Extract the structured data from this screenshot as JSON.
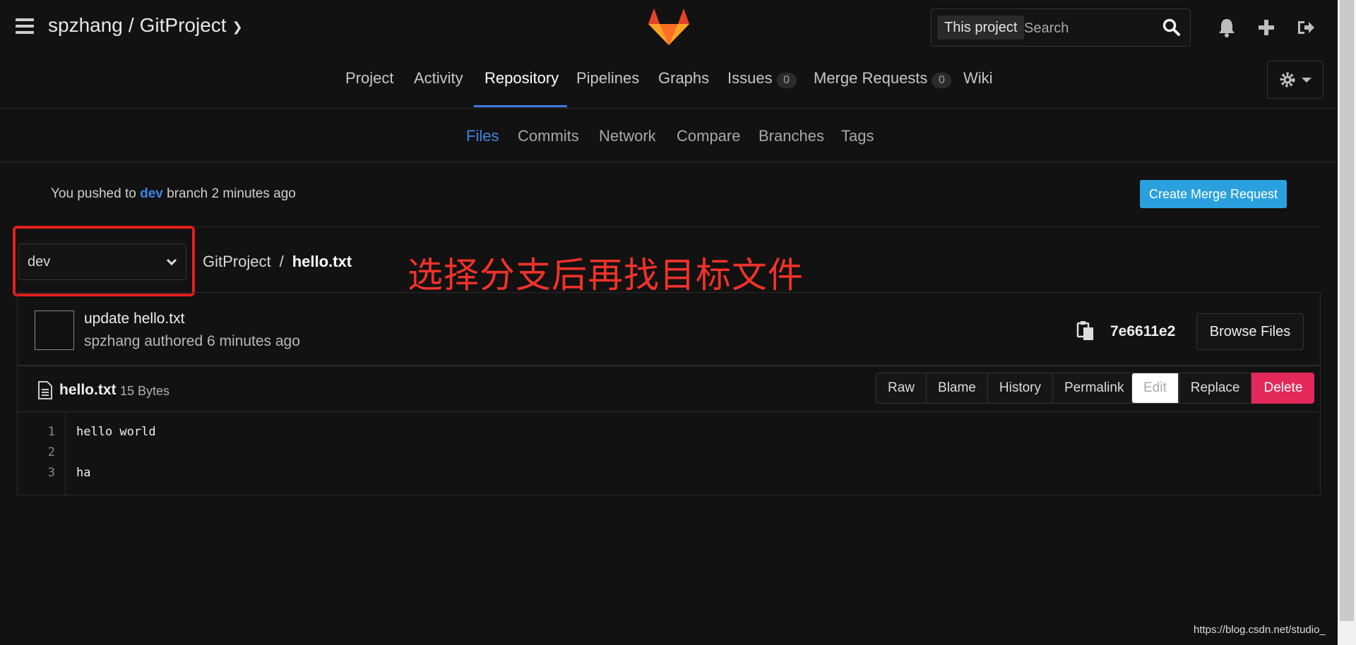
{
  "header": {
    "namespace": "spzhang",
    "separator": "/",
    "project": "GitProject",
    "search_scope": "This project",
    "search_placeholder": "Search"
  },
  "nav": {
    "items": [
      {
        "label": "Project"
      },
      {
        "label": "Activity"
      },
      {
        "label": "Repository"
      },
      {
        "label": "Pipelines"
      },
      {
        "label": "Graphs"
      },
      {
        "label": "Issues",
        "count": "0"
      },
      {
        "label": "Merge Requests",
        "count": "0"
      },
      {
        "label": "Wiki"
      }
    ],
    "active": "Repository"
  },
  "subnav": {
    "items": [
      "Files",
      "Commits",
      "Network",
      "Compare",
      "Branches",
      "Tags"
    ],
    "active": "Files"
  },
  "push_notice": {
    "prefix": "You pushed to",
    "branch": "dev",
    "suffix": "branch 2 minutes ago",
    "button": "Create Merge Request"
  },
  "branch_selector": {
    "value": "dev"
  },
  "breadcrumb": {
    "root": "GitProject",
    "sep": "/",
    "file": "hello.txt"
  },
  "annotation": "选择分支后再找目标文件",
  "commit": {
    "title": "update hello.txt",
    "meta": "spzhang authored 6 minutes ago",
    "sha": "7e6611e2",
    "browse_button": "Browse Files"
  },
  "file": {
    "name": "hello.txt",
    "size": "15 Bytes",
    "actions": [
      "Raw",
      "Blame",
      "History",
      "Permalink"
    ],
    "edit": "Edit",
    "replace": "Replace",
    "delete": "Delete",
    "lines": [
      {
        "no": "1",
        "text": "hello world"
      },
      {
        "no": "2",
        "text": ""
      },
      {
        "no": "3",
        "text": "ha"
      }
    ]
  },
  "watermark": "https://blog.csdn.net/studio_",
  "colors": {
    "accent": "#3d86e6",
    "create_mr": "#2aa1de",
    "delete": "#e3285a",
    "annotation": "#f0322a"
  }
}
